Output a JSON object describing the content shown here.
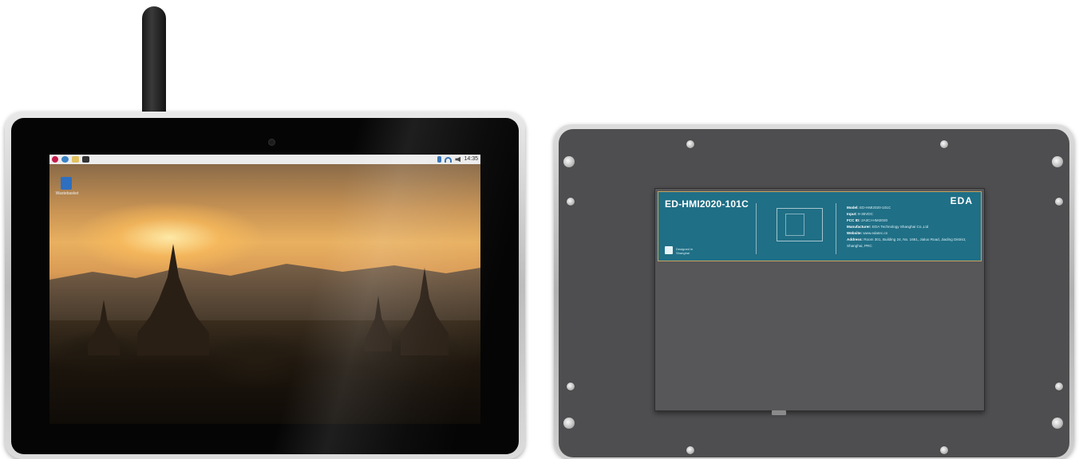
{
  "front": {
    "taskbar_clock": "14:35",
    "desktop_icon_label": "Wastebasket"
  },
  "back": {
    "model_title": "ED-HMI2020-101C",
    "brand": "EDA",
    "specs": [
      {
        "key": "Model:",
        "value": "ED-HMI2020-101C"
      },
      {
        "key": "Input:",
        "value": "9-36VDC"
      },
      {
        "key": "FCC ID:",
        "value": "2A3CI-HMI2020"
      },
      {
        "key": "Manufacturer:",
        "value": "EDA Technology Shanghai Co.,Ltd"
      },
      {
        "key": "Website:",
        "value": "www.edatec.cn"
      },
      {
        "key": "Address:",
        "value": "Room 301, Building 24, No. 1661, Jialuo Road, Jiading District, Shanghai, PRC"
      }
    ],
    "cert_text": "Designed in Shanghai"
  },
  "colors": {
    "label_panel": "#1f6f86",
    "back_plate": "#4e4e50"
  }
}
